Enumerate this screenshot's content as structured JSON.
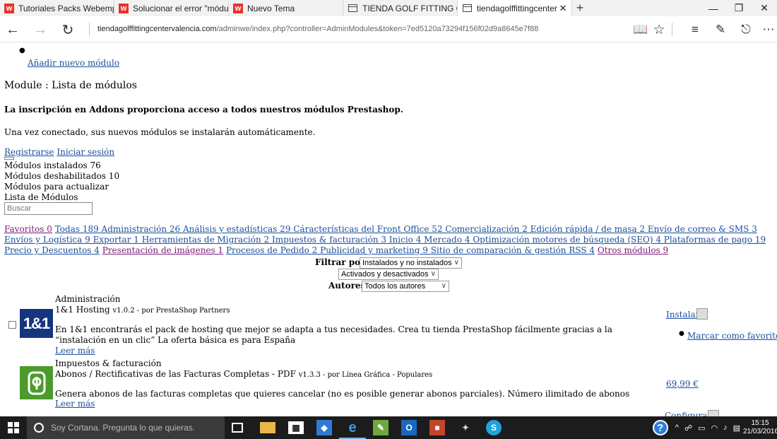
{
  "browser": {
    "tabs": [
      {
        "label": "Tutoriales Packs Webempre",
        "icon": "w-favicon"
      },
      {
        "label": "Solucionar el error \"módulo",
        "icon": "w-favicon"
      },
      {
        "label": "Nuevo Tema",
        "icon": "w-favicon"
      },
      {
        "label": "TIENDA GOLF FITTING CENT",
        "icon": "page-icon"
      },
      {
        "label": "tiendagolffittingcenterv:",
        "icon": "page-icon",
        "active": true
      }
    ],
    "url_domain": "tiendagolffittingcentervalencia.com",
    "url_path": "/adminwe/index.php?controller=AdminModules&token=7ed5120a73294f156f02d9a8645e7f88"
  },
  "page": {
    "add_module_link": "Añadir nuevo módulo",
    "heading": "Module : Lista de módulos",
    "addons_bold": "La inscripción en Addons proporciona acceso a todos nuestros módulos Prestashop.",
    "addons_text": "Una vez conectado, sus nuevos módulos se instalarán automáticamente.",
    "register_link": "Registrarse",
    "login_link": "Iniciar sesión",
    "stats": {
      "installed": "Módulos instalados 76",
      "disabled": "Módulos deshabilitados 10",
      "to_update": "Módulos para actualizar",
      "list": "Lista de Módulos"
    },
    "search_placeholder": "Buscar",
    "categories_line1": "Todas 189 Administración 26 Análisis y estadísticas 29 Cáracterísticas del Front Office 52 Comercialización 2 Edición rápida / de masa 2 Envío de correo & SMS 3 Envíos y Logística 9 Exportar 1 Herramientas de Migración 2 Impuestos & facturación 3 Inicio 4 Mercado 4 Optimización motores de búsqueda (SEO) 4 Plataformas de pago 19 Precio y Descuentos 4",
    "cat_favoritos": "Favoritos 0",
    "cat_presentacion": "Presentación de imágenes 1",
    "categories_line2": "Procesos de Pedido 2 Publicidad y marketing 9 Sitio de comparación & gestión RSS 4",
    "cat_otros": "Otros módulos 9",
    "filter": {
      "label": "Filtrar por",
      "status_value": "Instalados y no instalados",
      "active_value": "Activados y desactivados",
      "authors_label": "Autores",
      "authors_value": "Todos los autores"
    },
    "modules": [
      {
        "category": "Administración",
        "name": "1&1 Hosting",
        "meta": "v1.0.2 - por PrestaShop Partners",
        "description": "En 1&1 encontrarás el pack de hosting que mejor se adapta a tus necesidades. Crea tu tienda PrestaShop fácilmente gracias a la “instalación en un clic” La oferta básica es para España",
        "read_more": "Leer más",
        "action": "Instalar",
        "favorite": "Marcar como favorito",
        "logo_text": "1&1"
      },
      {
        "category": "Impuestos & facturación",
        "name": "Abonos / Rectificativas de las Facturas Completas - PDF",
        "meta": "v1.3.3 - por Línea Gráfica - Populares",
        "description": "Genera abonos de las facturas completas que quieres cancelar (no es posible generar abonos parciales). Número ilimitado de abonos",
        "read_more": "Leer más",
        "price": "69,99 €",
        "next_action": "Configurar"
      }
    ]
  },
  "taskbar": {
    "cortana_text": "Soy Cortana. Pregunta lo que quieras.",
    "time": "15:15",
    "date": "21/03/2016"
  }
}
